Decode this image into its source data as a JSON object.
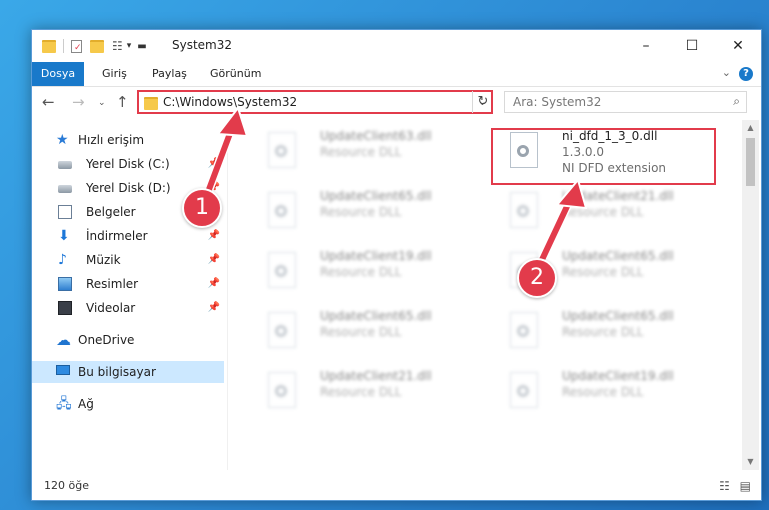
{
  "window": {
    "title": "System32",
    "controls": {
      "minimize": "–",
      "maximize": "☐",
      "close": "✕"
    }
  },
  "ribbon": {
    "tabs": [
      "Dosya",
      "Giriş",
      "Paylaş",
      "Görünüm"
    ],
    "help_label": "?"
  },
  "navigation": {
    "address": "C:\\Windows\\System32",
    "search_placeholder": "Ara: System32"
  },
  "sidebar": {
    "items": [
      {
        "label": "Hızlı erişim",
        "icon": "star-icon"
      },
      {
        "label": "Yerel Disk (C:)",
        "icon": "drive-icon",
        "pinned": true
      },
      {
        "label": "Yerel Disk (D:)",
        "icon": "drive-icon",
        "pinned": true
      },
      {
        "label": "Belgeler",
        "icon": "documents-icon",
        "pinned": true
      },
      {
        "label": "İndirmeler",
        "icon": "downloads-icon",
        "pinned": true
      },
      {
        "label": "Müzik",
        "icon": "music-icon",
        "pinned": true
      },
      {
        "label": "Resimler",
        "icon": "pictures-icon",
        "pinned": true
      },
      {
        "label": "Videolar",
        "icon": "videos-icon",
        "pinned": true
      },
      {
        "label": "OneDrive",
        "icon": "onedrive-icon"
      },
      {
        "label": "Bu bilgisayar",
        "icon": "computer-icon",
        "selected": true
      },
      {
        "label": "Ağ",
        "icon": "network-icon"
      }
    ]
  },
  "files": [
    {
      "name": "UpdateClient63.dll",
      "desc": "Resource DLL"
    },
    {
      "name": "ni_dfd_1_3_0.dll",
      "version": "1.3.0.0",
      "desc": "NI DFD extension",
      "highlighted": true
    },
    {
      "name": "UpdateClient65.dll",
      "desc": "Resource DLL"
    },
    {
      "name": "UpdateClient21.dll",
      "desc": "Resource DLL"
    },
    {
      "name": "UpdateClient19.dll",
      "desc": "Resource DLL"
    },
    {
      "name": "UpdateClient65.dll",
      "desc": "Resource DLL"
    },
    {
      "name": "UpdateClient65.dll",
      "desc": "Resource DLL"
    },
    {
      "name": "UpdateClient65.dll",
      "desc": "Resource DLL"
    },
    {
      "name": "UpdateClient21.dll",
      "desc": "Resource DLL"
    },
    {
      "name": "UpdateClient19.dll",
      "desc": "Resource DLL"
    }
  ],
  "status": {
    "item_count": "120 öğe"
  },
  "callouts": [
    {
      "number": "1"
    },
    {
      "number": "2"
    }
  ],
  "colors": {
    "accent": "#1979ca",
    "highlight": "#e23b4b",
    "selection": "#cce8ff"
  }
}
